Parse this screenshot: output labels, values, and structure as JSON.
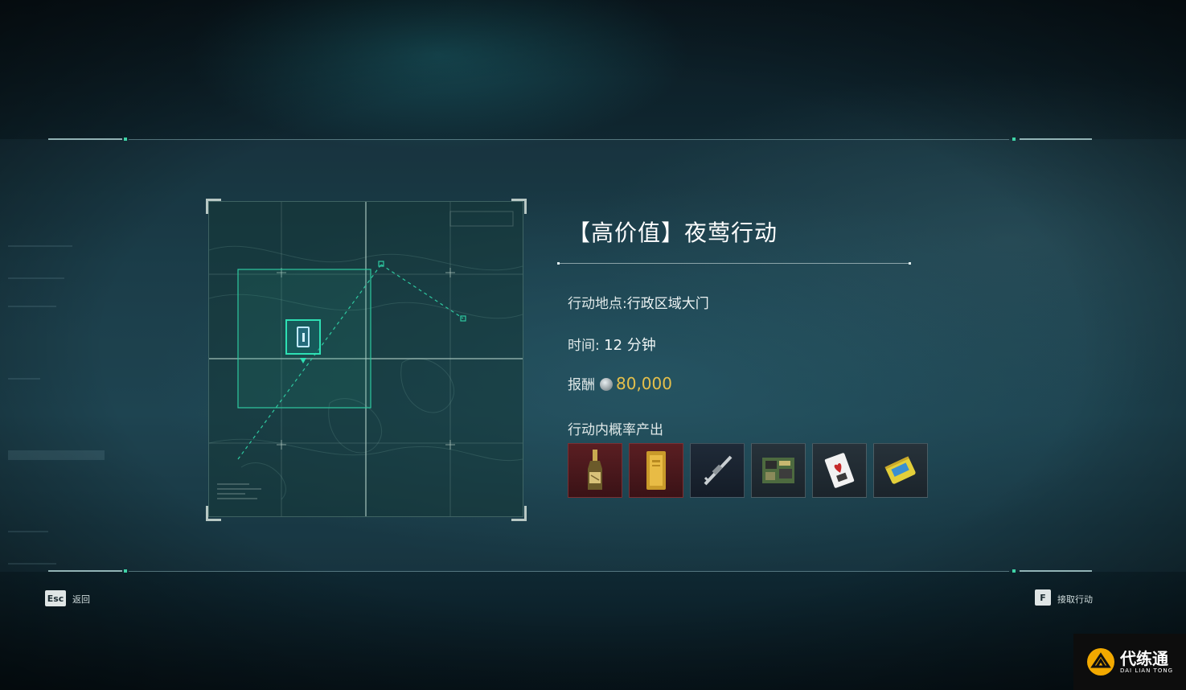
{
  "mission": {
    "title": "【高价值】夜莺行动",
    "location_label": "行动地点:",
    "location_value": "行政区域大门",
    "time_label": "时间:",
    "time_value": "12 分钟",
    "reward_label": "报酬",
    "reward_value": "80,000",
    "loot_label": "行动内概率产出",
    "loot_items": [
      {
        "icon": "champagne-bottle-icon",
        "rarity_color": "#5a1e22"
      },
      {
        "icon": "gold-bar-icon",
        "rarity_color": "#5a1e22"
      },
      {
        "icon": "rifle-scope-icon",
        "rarity_color": "#1f2a38"
      },
      {
        "icon": "circuit-board-icon",
        "rarity_color": "#27323a"
      },
      {
        "icon": "playing-card-icon",
        "rarity_color": "#27323a"
      },
      {
        "icon": "snack-bag-icon",
        "rarity_color": "#27323a"
      }
    ]
  },
  "map": {
    "marker_icon": "objective-marker-icon",
    "accent_color": "#2ee0b3"
  },
  "footer": {
    "back_key": "Esc",
    "back_label": "返回",
    "accept_key": "F",
    "accept_label": "接取行动"
  },
  "watermark": {
    "name_cn": "代练通",
    "name_en": "DAI LIAN TONG"
  }
}
